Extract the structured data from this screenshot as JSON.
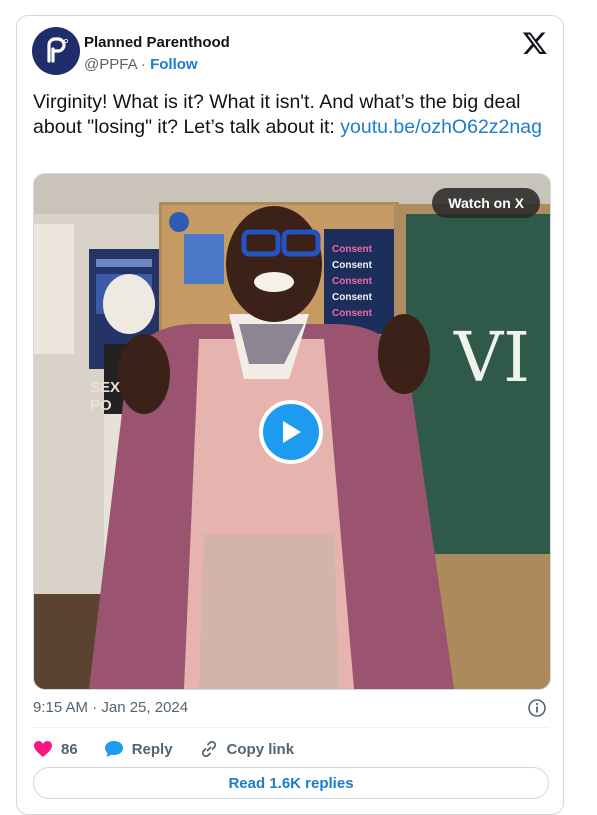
{
  "author": {
    "name": "Planned Parenthood",
    "handle": "@PPFA",
    "separator": "·",
    "follow_label": "Follow"
  },
  "tweet": {
    "text_before": "Virginity! What is it? What it isn't. And what’s the big deal about \"losing\" it? Let’s talk about it: ",
    "link_text": "youtu.be/ozhO62z2nag"
  },
  "media": {
    "watch_label": "Watch on X",
    "board_words": [
      "Consent",
      "Consent",
      "Consent",
      "Consent",
      "Consent"
    ],
    "chalk_text": "VI",
    "shirt_text_1": "SEX",
    "shirt_text_2": "PO"
  },
  "meta": {
    "timestamp": "9:15 AM · Jan 25, 2024"
  },
  "actions": {
    "likes_count": "86",
    "reply_label": "Reply",
    "copy_label": "Copy link"
  },
  "footer": {
    "read_replies_label": "Read 1.6K replies"
  },
  "colors": {
    "brand": "#1f2d6b",
    "link": "#1d7ccb",
    "like": "#f91880",
    "play": "#1d9bf0"
  },
  "icons": [
    "planned-parenthood-logo",
    "x-logo-icon",
    "play-icon",
    "info-icon",
    "heart-icon",
    "reply-bubble-icon",
    "link-icon"
  ]
}
